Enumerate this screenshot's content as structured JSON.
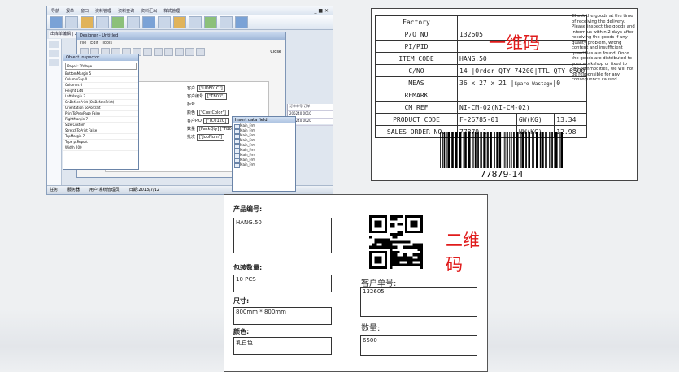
{
  "app": {
    "menu": [
      "导航",
      "报单",
      "窗口",
      "资料管理",
      "资料查询",
      "资料汇出",
      "样式管理"
    ],
    "order_tab": "出库单编辑 | 20",
    "designer": {
      "title": "Designer - Untitled",
      "menu": [
        "File",
        "Edit",
        "Tools"
      ],
      "close_label": "Close",
      "canvas_rows": [
        {
          "label": "客户",
          "field": "[\"UDF01C\"]"
        },
        {
          "label": "客户编号",
          "field": "[\"TB03\"]"
        },
        {
          "label": "柜号",
          "field": ""
        },
        {
          "label": "颜色",
          "field": "[\"CustColor\"]"
        },
        {
          "label": "客户P.O",
          "field": "[\"TC012C]"
        },
        {
          "label": "数量",
          "field": "[PackQty] [\"TB028\"]"
        },
        {
          "label": "批次",
          "field": "[\"JobNum\"]"
        }
      ]
    },
    "inspector": {
      "title": "Object Inspector",
      "selected": "Page1: TfrPage",
      "props": [
        "BottomMargin",
        "ColumnGap",
        "Columns",
        "Height",
        "LeftMargin",
        "OnBeforePrint",
        "Orientation",
        "PrintToPrevPage",
        "RightMargin",
        "Size",
        "StretchToPrint",
        "TopMargin",
        "Type",
        "Width"
      ],
      "values": [
        "5",
        "0",
        "0",
        "144",
        "7",
        "(OnBeforePrint)",
        "poPortrait",
        "False",
        "7",
        "Custom",
        "False",
        "7",
        "ptReport",
        "200"
      ]
    },
    "insert_field": {
      "title": "Insert data field",
      "items": [
        "Main_Frm",
        "Main_Frm",
        "Main_Frm",
        "Main_Frm",
        "Main_Frm",
        "Main_Frm",
        "Main_Frm",
        "Main_Frm",
        "Main_Frm"
      ]
    },
    "grid": [
      "订单单号 订单",
      "205240 0010",
      "205240 0020"
    ],
    "status": [
      "任务",
      "服务器",
      "用户:系统管理员",
      "日期:2013/7/12"
    ]
  },
  "label1": {
    "rows": [
      {
        "label": "Factory",
        "value": ""
      },
      {
        "label": "P/O NO",
        "value": "132605"
      },
      {
        "label": "PI/PID",
        "value": ""
      },
      {
        "label": "ITEM CODE",
        "value": "HANG.50"
      },
      {
        "label": "C/NO",
        "value": "14",
        "extra_label": "Order QTY",
        "extra_value": "74200",
        "extra_label2": "TTL QTY",
        "extra_value2": "6500"
      },
      {
        "label": "MEAS",
        "value": "36 x 27 x 21",
        "extra_label": "Spare Wastage",
        "extra_value": "0"
      },
      {
        "label": "REMARK",
        "value": ""
      },
      {
        "label": "CM REF",
        "value": "NI-CM-02(NI-CM-02)"
      },
      {
        "label": "PRODUCT CODE",
        "value": "F-26785-01",
        "extra_label": "GW(KG)",
        "extra_value": "13.34"
      },
      {
        "label": "SALES ORDER NO.",
        "value": "77879-1",
        "extra_label": "NW(KG)",
        "extra_value": "12.98"
      }
    ],
    "note": "Check the goods at the time of receiving the delivery. Please inspect the goods and inform us within 2 days after receiving the goods if any quality problem, wrong content and insufficient quantities are found. Once the goods are distributed to your workshop or fixed to the commodities, we will not be responsible for any consequence caused.",
    "barcode_number": "77879-14",
    "annotation": "一维码"
  },
  "label2": {
    "annotation": "二维码",
    "product_no_label": "产品编号:",
    "product_no": "HANG.50",
    "pack_qty_label": "包装数量:",
    "pack_qty": "10 PCS",
    "size_label": "尺寸:",
    "size": "800mm * 800mm",
    "color_label": "颜色:",
    "color": "乳白色",
    "customer_no_label": "客户单号:",
    "customer_no": "132605",
    "qty_label": "数量:",
    "qty": "6500"
  }
}
